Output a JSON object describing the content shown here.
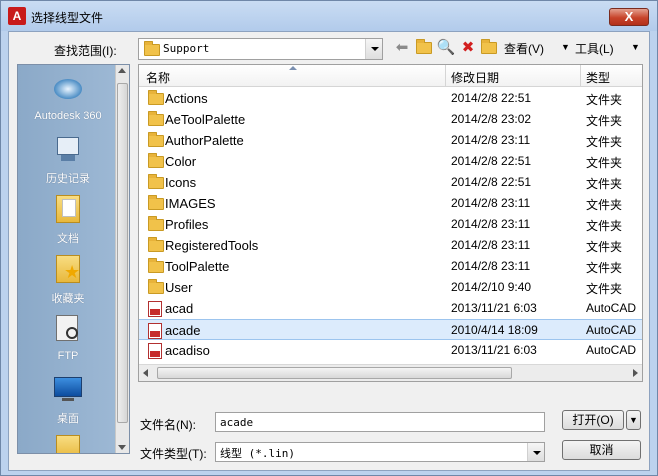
{
  "window": {
    "title": "选择线型文件",
    "close_label": "X",
    "app_icon": "A"
  },
  "toolbar": {
    "lookin_label": "查找范围(I):",
    "lookin_value": "Support",
    "icons": [
      "back-arrow-icon",
      "up-folder-icon",
      "search-web-icon",
      "delete-icon",
      "new-folder-icon"
    ],
    "view_label": "查看(V)",
    "tools_label": "工具(L)"
  },
  "places": [
    {
      "label": "Autodesk 360",
      "icon": "autodesk360-icon"
    },
    {
      "label": "历史记录",
      "icon": "history-icon"
    },
    {
      "label": "文档",
      "icon": "documents-icon"
    },
    {
      "label": "收藏夹",
      "icon": "favorites-icon"
    },
    {
      "label": "FTP",
      "icon": "ftp-icon"
    },
    {
      "label": "桌面",
      "icon": "desktop-icon"
    }
  ],
  "filelist": {
    "columns": [
      "名称",
      "修改日期",
      "类型"
    ],
    "rows": [
      {
        "name": "Actions",
        "date": "2014/2/8 22:51",
        "type": "文件夹",
        "kind": "folder"
      },
      {
        "name": "AeToolPalette",
        "date": "2014/2/8 23:02",
        "type": "文件夹",
        "kind": "folder"
      },
      {
        "name": "AuthorPalette",
        "date": "2014/2/8 23:11",
        "type": "文件夹",
        "kind": "folder"
      },
      {
        "name": "Color",
        "date": "2014/2/8 22:51",
        "type": "文件夹",
        "kind": "folder"
      },
      {
        "name": "Icons",
        "date": "2014/2/8 22:51",
        "type": "文件夹",
        "kind": "folder"
      },
      {
        "name": "IMAGES",
        "date": "2014/2/8 23:11",
        "type": "文件夹",
        "kind": "folder"
      },
      {
        "name": "Profiles",
        "date": "2014/2/8 23:11",
        "type": "文件夹",
        "kind": "folder"
      },
      {
        "name": "RegisteredTools",
        "date": "2014/2/8 23:11",
        "type": "文件夹",
        "kind": "folder"
      },
      {
        "name": "ToolPalette",
        "date": "2014/2/8 23:11",
        "type": "文件夹",
        "kind": "folder"
      },
      {
        "name": "User",
        "date": "2014/2/10 9:40",
        "type": "文件夹",
        "kind": "folder"
      },
      {
        "name": "acad",
        "date": "2013/11/21 6:03",
        "type": "AutoCAD",
        "kind": "file"
      },
      {
        "name": "acade",
        "date": "2010/4/14 18:09",
        "type": "AutoCAD",
        "kind": "file",
        "selected": true
      },
      {
        "name": "acadiso",
        "date": "2013/11/21 6:03",
        "type": "AutoCAD",
        "kind": "file"
      }
    ]
  },
  "bottom": {
    "filename_label": "文件名(N):",
    "filename_value": "acade",
    "filetype_label": "文件类型(T):",
    "filetype_value": "线型 (*.lin)",
    "open_label": "打开(O)",
    "cancel_label": "取消"
  }
}
